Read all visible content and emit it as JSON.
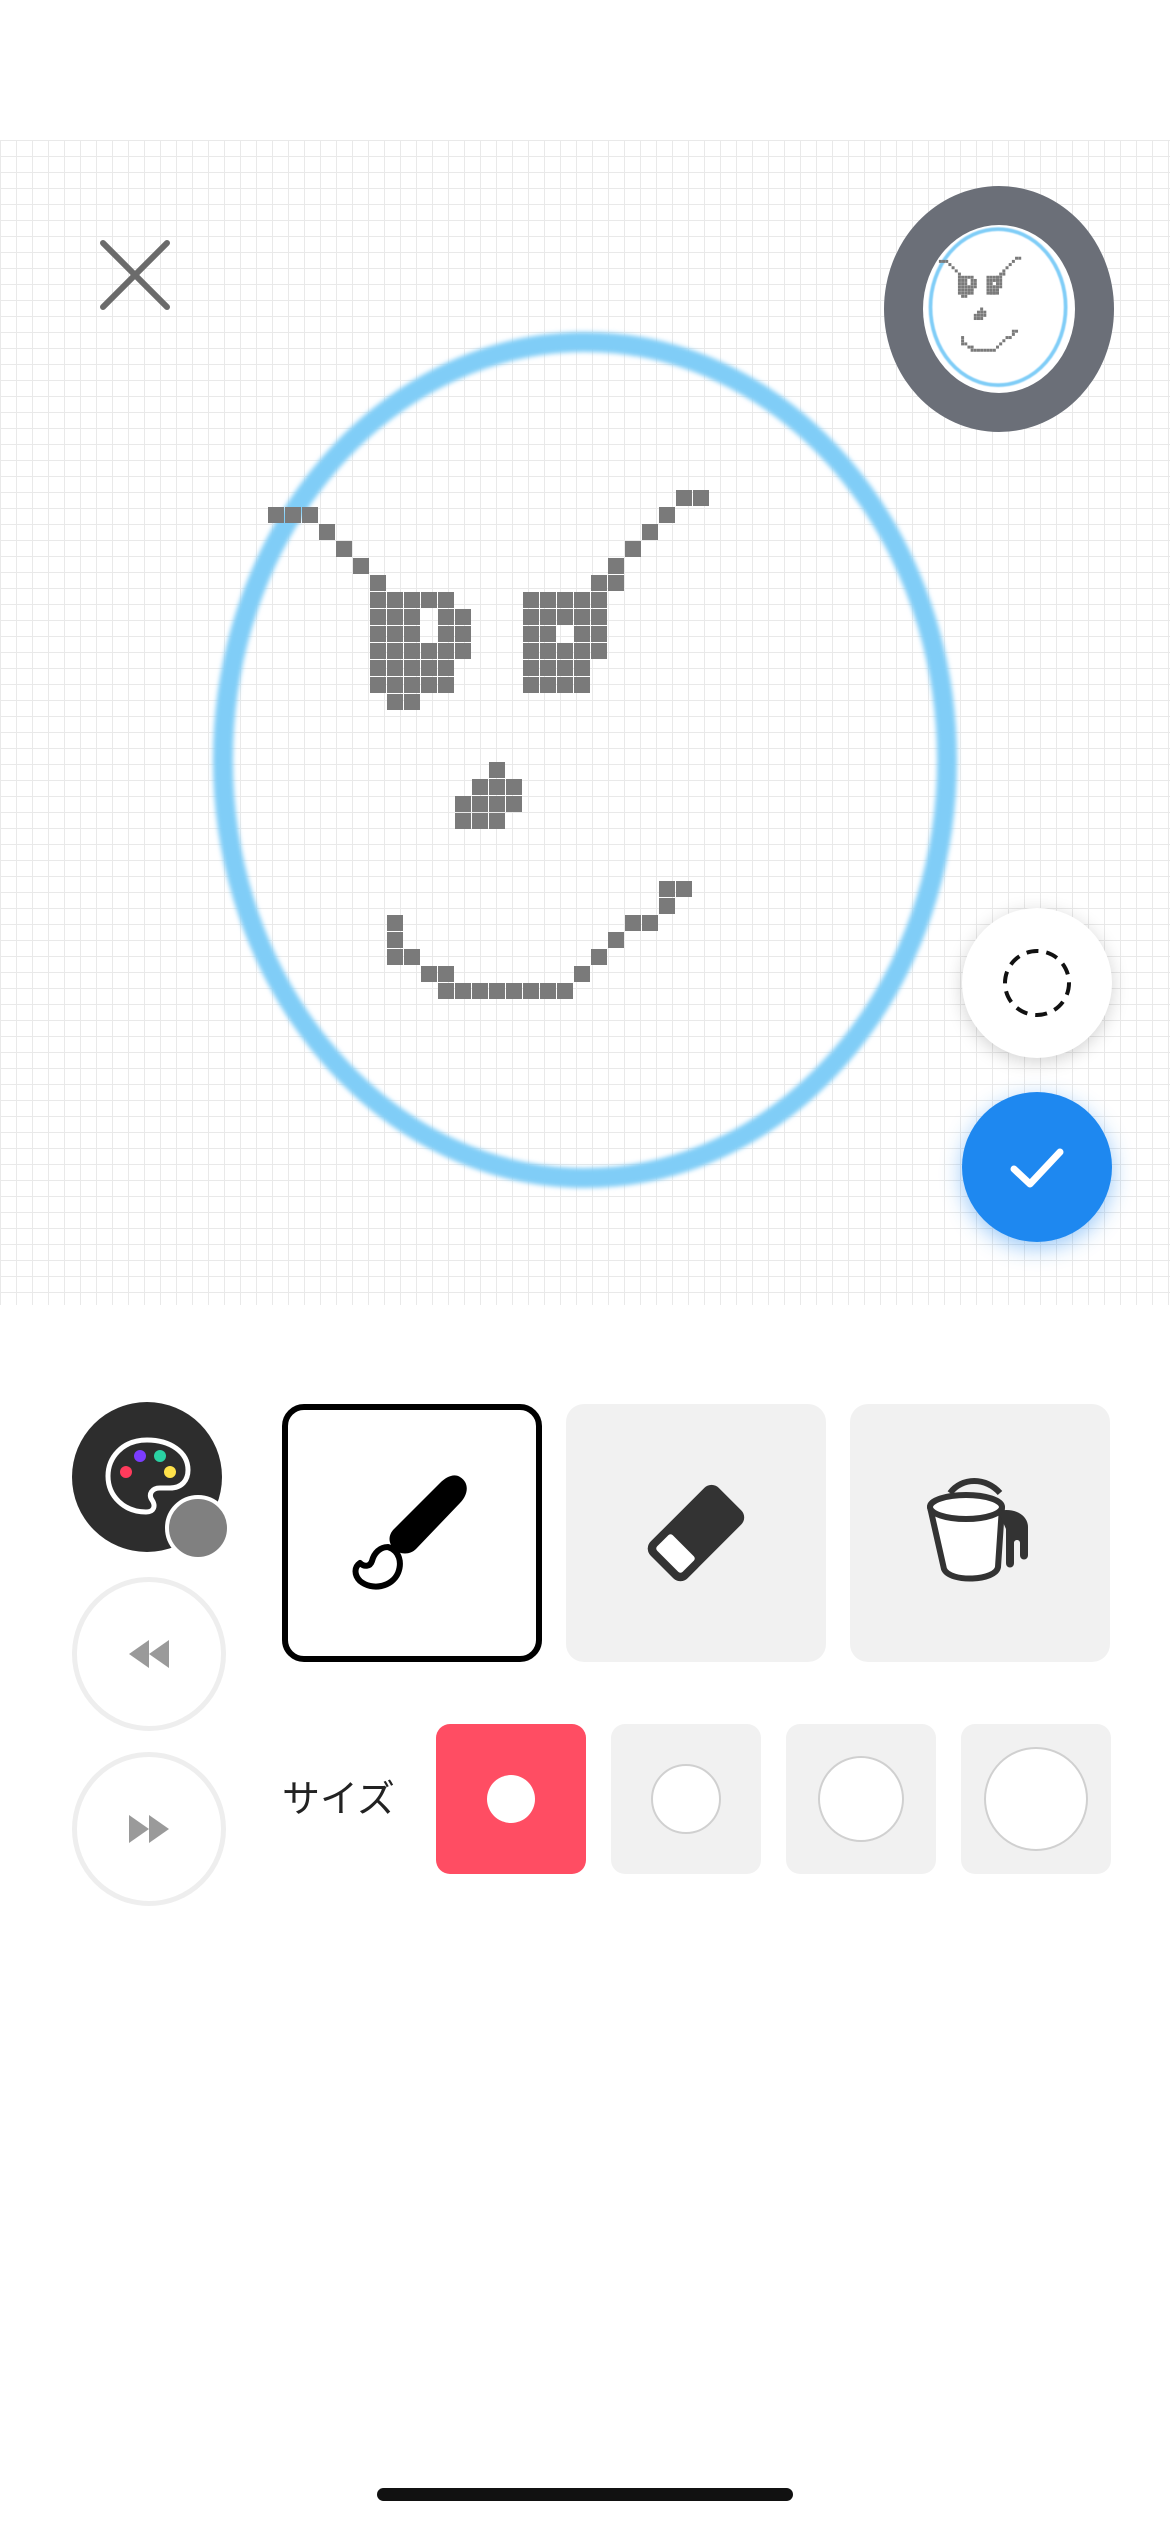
{
  "header": {
    "close_icon": "close-icon"
  },
  "canvas": {
    "grid": true,
    "stroke_color": "#80cdf7",
    "pixel_color": "#7a7a7a",
    "background": "#ffffff"
  },
  "preview": {
    "ring_color": "#6b6f78",
    "icon": "preview-thumbnail"
  },
  "actions": {
    "lasso_icon": "dashed-circle-icon",
    "confirm_icon": "checkmark-icon",
    "confirm_color": "#1e88f0"
  },
  "toolbar": {
    "palette_icon": "palette-icon",
    "current_color": "#808080",
    "undo_icon": "rewind-icon",
    "redo_icon": "fast-forward-icon",
    "tools": [
      {
        "name": "brush",
        "icon": "brush-icon",
        "selected": true
      },
      {
        "name": "eraser",
        "icon": "eraser-icon",
        "selected": false
      },
      {
        "name": "fill",
        "icon": "paint-bucket-icon",
        "selected": false
      }
    ]
  },
  "size": {
    "label": "サイズ",
    "options": [
      {
        "level": 1,
        "selected": true
      },
      {
        "level": 2,
        "selected": false
      },
      {
        "level": 3,
        "selected": false
      },
      {
        "level": 4,
        "selected": false
      }
    ],
    "accent": "#ff4d63"
  }
}
